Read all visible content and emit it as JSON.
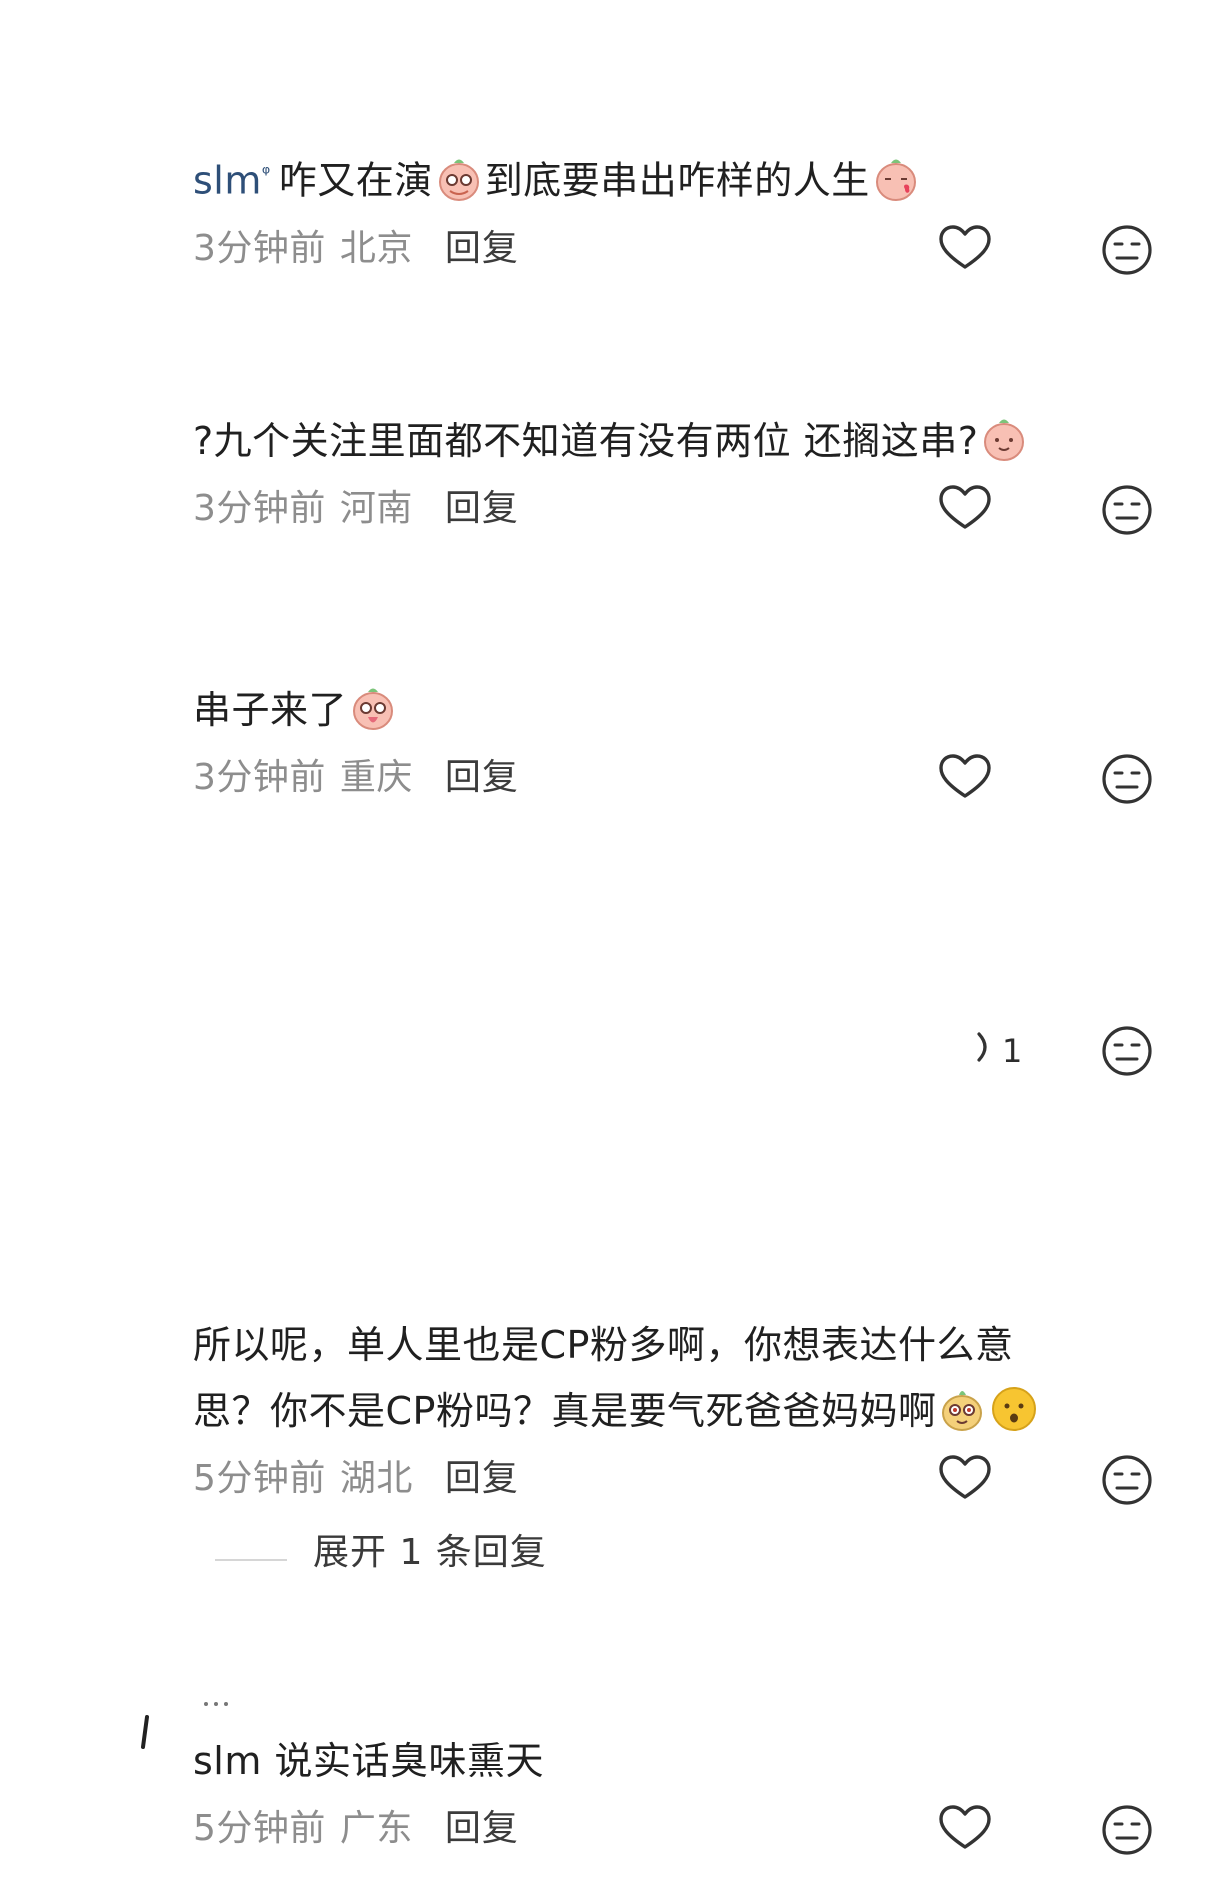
{
  "comments": [
    {
      "username": "slm",
      "text": "咋又在演",
      "text_after_emoji": "到底要串出咋样的人生",
      "time": "3分钟前",
      "location": "北京",
      "reply_label": "回复"
    },
    {
      "text": "?九个关注里面都不知道有没有两位 还搁这串?",
      "time": "3分钟前",
      "location": "河南",
      "reply_label": "回复"
    },
    {
      "text": "串子来了",
      "time": "3分钟前",
      "location": "重庆",
      "reply_label": "回复"
    },
    {
      "text_line1": "所以呢，单人里也是CP粉多啊，你想表达什么意",
      "text_line2": "思？你不是CP粉吗？真是要气死爸爸妈妈啊",
      "time": "5分钟前",
      "location": "湖北",
      "reply_label": "回复",
      "expand_label": "展开 1 条回复"
    },
    {
      "text": "slm 说实话臭味熏天",
      "time": "5分钟前",
      "location": "广东",
      "reply_label": "回复"
    }
  ],
  "collapsed": {
    "reply_count": "1"
  },
  "icons": {
    "like": "heart-outline-icon",
    "dislike": "expressionless-face-icon",
    "reply_count": "speech-bubble-icon"
  },
  "colors": {
    "text": "#202020",
    "meta": "#8d8d8d",
    "username": "#2e4f78",
    "icon_stroke": "#333333"
  }
}
